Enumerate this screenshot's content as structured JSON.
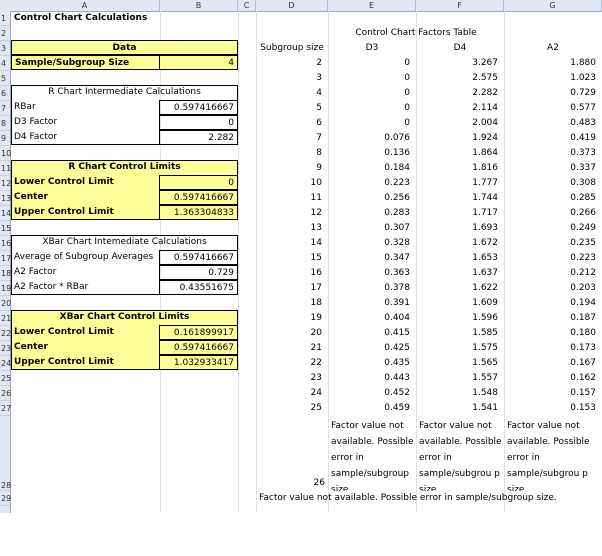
{
  "column_headers": [
    "A",
    "B",
    "C",
    "D",
    "E",
    "F",
    "G"
  ],
  "row_numbers": [
    "1",
    "2",
    "3",
    "4",
    "5",
    "6",
    "7",
    "8",
    "9",
    "10",
    "11",
    "12",
    "13",
    "14",
    "15",
    "16",
    "17",
    "18",
    "19",
    "20",
    "21",
    "22",
    "23",
    "24",
    "25",
    "26",
    "27",
    "28",
    "29"
  ],
  "title": "Control Chart Calculations",
  "data_section": {
    "header": "Data",
    "sample_label": "Sample/Subgroup Size",
    "sample_value": "4"
  },
  "r_intermediate": {
    "header": "R Chart Intermediate Calculations",
    "rows": [
      {
        "label": "RBar",
        "value": "0.597416667"
      },
      {
        "label": "D3 Factor",
        "value": "0"
      },
      {
        "label": "D4 Factor",
        "value": "2.282"
      }
    ]
  },
  "r_limits": {
    "header": "R Chart Control Limits",
    "rows": [
      {
        "label": "Lower Control Limit",
        "value": "0"
      },
      {
        "label": "Center",
        "value": "0.597416667"
      },
      {
        "label": "Upper Control Limit",
        "value": "1.363304833"
      }
    ]
  },
  "xbar_intermediate": {
    "header": "XBar Chart Intemediate Calculations",
    "rows": [
      {
        "label": "Average of Subgroup Averages",
        "value": "0.597416667"
      },
      {
        "label": "A2 Factor",
        "value": "0.729"
      },
      {
        "label": "A2 Factor * RBar",
        "value": "0.43551675"
      }
    ]
  },
  "xbar_limits": {
    "header": "XBar Chart Control Limits",
    "rows": [
      {
        "label": "Lower Control Limit",
        "value": "0.161899917"
      },
      {
        "label": "Center",
        "value": "0.597416667"
      },
      {
        "label": "Upper Control Limit",
        "value": "1.032933417"
      }
    ]
  },
  "factors_table": {
    "title": "Control Chart Factors Table",
    "headers": [
      "Subgroup size",
      "D3",
      "D4",
      "A2"
    ],
    "rows": [
      [
        "2",
        "0",
        "3.267",
        "1.880"
      ],
      [
        "3",
        "0",
        "2.575",
        "1.023"
      ],
      [
        "4",
        "0",
        "2.282",
        "0.729"
      ],
      [
        "5",
        "0",
        "2.114",
        "0.577"
      ],
      [
        "6",
        "0",
        "2.004",
        "0.483"
      ],
      [
        "7",
        "0.076",
        "1.924",
        "0.419"
      ],
      [
        "8",
        "0.136",
        "1.864",
        "0.373"
      ],
      [
        "9",
        "0.184",
        "1.816",
        "0.337"
      ],
      [
        "10",
        "0.223",
        "1.777",
        "0.308"
      ],
      [
        "11",
        "0.256",
        "1.744",
        "0.285"
      ],
      [
        "12",
        "0.283",
        "1.717",
        "0.266"
      ],
      [
        "13",
        "0.307",
        "1.693",
        "0.249"
      ],
      [
        "14",
        "0.328",
        "1.672",
        "0.235"
      ],
      [
        "15",
        "0.347",
        "1.653",
        "0.223"
      ],
      [
        "16",
        "0.363",
        "1.637",
        "0.212"
      ],
      [
        "17",
        "0.378",
        "1.622",
        "0.203"
      ],
      [
        "18",
        "0.391",
        "1.609",
        "0.194"
      ],
      [
        "19",
        "0.404",
        "1.596",
        "0.187"
      ],
      [
        "20",
        "0.415",
        "1.585",
        "0.180"
      ],
      [
        "21",
        "0.425",
        "1.575",
        "0.173"
      ],
      [
        "22",
        "0.435",
        "1.565",
        "0.167"
      ],
      [
        "23",
        "0.443",
        "1.557",
        "0.162"
      ],
      [
        "24",
        "0.452",
        "1.548",
        "0.157"
      ],
      [
        "25",
        "0.459",
        "1.541",
        "0.153"
      ]
    ],
    "row26_size": "26",
    "row26_e": "Factor value not available. Possible error in sample/subgroup size.",
    "row26_f": "Factor value not available. Possible error in sample/subgrou p size.",
    "row26_g": "Factor value not available. Possible error in sample/subgrou p size.",
    "row29_message": "Factor value not available. Possible error in sample/subgroup size."
  }
}
